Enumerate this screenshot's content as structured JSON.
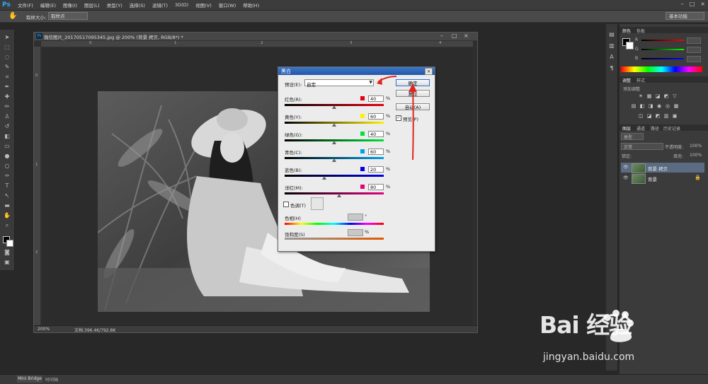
{
  "menubar": {
    "logo": "Ps",
    "items": [
      "文件(F)",
      "编辑(E)",
      "图像(I)",
      "图层(L)",
      "类型(Y)",
      "选择(S)",
      "滤镜(T)",
      "3D(D)",
      "视图(V)",
      "窗口(W)",
      "帮助(H)"
    ],
    "window_controls": [
      "–",
      "□",
      "×"
    ]
  },
  "options": {
    "sample_size_label": "取样大小:",
    "sample_size_value": "取样点",
    "workspace": "基本功能"
  },
  "document": {
    "title": "微信图片_20170517095345.jpg @ 200% (背景 拷贝, RGB/8*) *",
    "zoom": "200%",
    "doc_info": "文档:396.4K/792.8K",
    "ruler_top": [
      "0",
      "1",
      "2",
      "3",
      "4"
    ],
    "ruler_left": [
      "0",
      "1",
      "2"
    ]
  },
  "dialog": {
    "title": "黑白",
    "close": "×",
    "preset_label": "预设(E):",
    "preset_value": "自定",
    "channels": [
      {
        "label": "红色(R):",
        "value": "40",
        "color": "#e60012",
        "thumb": 0.5
      },
      {
        "label": "黄色(Y):",
        "value": "60",
        "color": "#fff100",
        "thumb": 0.5
      },
      {
        "label": "绿色(G):",
        "value": "40",
        "color": "#00e33a",
        "thumb": 0.5
      },
      {
        "label": "青色(C):",
        "value": "60",
        "color": "#00a0e9",
        "thumb": 0.5
      },
      {
        "label": "蓝色(B):",
        "value": "20",
        "color": "#0000e6",
        "thumb": 0.4
      },
      {
        "label": "洋红(M):",
        "value": "80",
        "color": "#e4007f",
        "thumb": 0.55
      }
    ],
    "percent": "%",
    "tint_label": "色调(T)",
    "hue_label": "色相(H)",
    "hue_unit": "°",
    "saturation_label": "饱和度(S)",
    "saturation_unit": "%",
    "ok_label": "确定",
    "cancel_label": "复位",
    "auto_label": "自动(A)",
    "preview_label": "预览(P)",
    "preview_checked": "✓"
  },
  "panels": {
    "color_tabs": [
      "颜色",
      "色板"
    ],
    "color_rows": [
      "R",
      "G",
      "B"
    ],
    "adjust_tabs": [
      "调整",
      "样式"
    ],
    "adjust_hint": "添加调整",
    "layers_tabs": [
      "图层",
      "通道",
      "路径",
      "历史记录"
    ],
    "kind_label": "类型",
    "blend_mode": "正常",
    "opacity_label": "不透明度:",
    "opacity_value": "100%",
    "lock_label": "锁定:",
    "fill_label": "填充:",
    "fill_value": "100%",
    "layers": [
      {
        "name": "背景 拷贝",
        "selected": true
      },
      {
        "name": "背景",
        "selected": false
      }
    ]
  },
  "bottom": {
    "mini_bridge": "Mini Bridge",
    "timeline": "时间轴"
  },
  "watermark": {
    "brand": "Bai 经验",
    "url": "jingyan.baidu.com"
  }
}
